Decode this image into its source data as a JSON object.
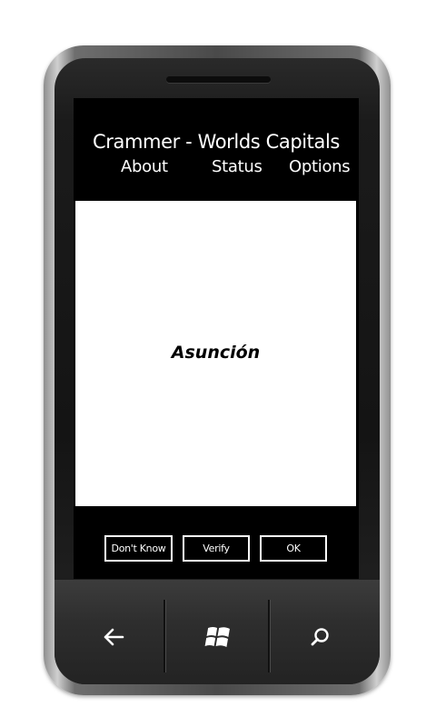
{
  "app": {
    "title": "Crammer - Worlds Capitals"
  },
  "menu": {
    "about": "About",
    "status": "Status",
    "options": "Options"
  },
  "card": {
    "word": "Asunción"
  },
  "buttons": {
    "dont_know": "Don't Know",
    "verify": "Verify",
    "ok": "OK"
  },
  "hardware_keys": {
    "back_icon": "back-arrow-icon",
    "start_icon": "windows-logo-icon",
    "search_icon": "search-icon"
  },
  "colors": {
    "screen_background": "#000000",
    "card_background": "#ffffff",
    "text_on_dark": "#ffffff",
    "text_on_light": "#000000"
  }
}
